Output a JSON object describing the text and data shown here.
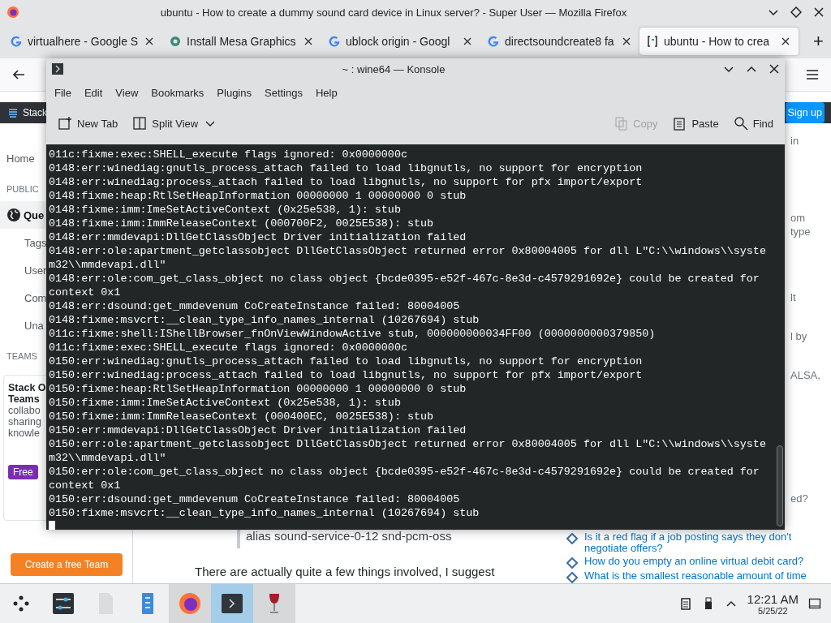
{
  "browser": {
    "title": "ubuntu - How to create a dummy sound card device in Linux server? - Super User — Mozilla Firefox",
    "tabs": [
      {
        "label": "virtualhere - Google S",
        "kind": "google",
        "selected": false
      },
      {
        "label": "Install Mesa Graphics",
        "kind": "gear",
        "selected": false
      },
      {
        "label": "ublock origin - Googl",
        "kind": "google",
        "selected": false
      },
      {
        "label": "directsoundcreate8 fa",
        "kind": "google",
        "selected": false
      },
      {
        "label": "ubuntu - How to crea",
        "kind": "stack",
        "selected": true
      }
    ],
    "new_tab": "+"
  },
  "site": {
    "header": {
      "brand": "Stack",
      "signup": "Sign up"
    },
    "left_nav": [
      {
        "kind": "link",
        "label": "Home",
        "selected": false
      },
      {
        "kind": "heading",
        "label": "PUBLIC"
      },
      {
        "kind": "globe",
        "label": "Que",
        "selected": true
      },
      {
        "kind": "sub",
        "label": "Tags",
        "selected": false
      },
      {
        "kind": "sub",
        "label": "User",
        "selected": false
      },
      {
        "kind": "sub",
        "label": "Com",
        "selected": false
      },
      {
        "kind": "sub",
        "label": "Una",
        "selected": false
      },
      {
        "kind": "heading",
        "label": "TEAMS"
      }
    ],
    "teams_card": {
      "title": "Stack O",
      "title_2": "Teams",
      "lines": [
        "collabo",
        "sharing",
        "knowle"
      ],
      "badge": "Free",
      "button": "Create a free Team"
    },
    "main": {
      "code_line": "alias sound-service-0-12 snd-pcm-oss",
      "paragraph": "There are actually quite a few things involved, I suggest"
    },
    "right": {
      "fragments": [
        "in",
        "om",
        "type",
        "lt",
        "l by",
        "ALSA,",
        "ed?"
      ],
      "hot_questions": [
        "Is it a red flag if a job posting says they don't negotiate offers?",
        "How do you empty an online virtual debit card?",
        "What is the smallest reasonable amount of time"
      ]
    }
  },
  "konsole": {
    "title": "~ : wine64 — Konsole",
    "menu": [
      "File",
      "Edit",
      "View",
      "Bookmarks",
      "Plugins",
      "Settings",
      "Help"
    ],
    "toolbar": [
      {
        "kind": "new-tab",
        "label": "New Tab",
        "disabled": false
      },
      {
        "kind": "split",
        "label": "Split View",
        "disabled": false
      },
      {
        "kind": "copy",
        "label": "Copy",
        "disabled": true
      },
      {
        "kind": "paste",
        "label": "Paste",
        "disabled": false
      },
      {
        "kind": "find",
        "label": "Find",
        "disabled": false
      }
    ],
    "lines": [
      "011c:fixme:exec:SHELL_execute flags ignored: 0x0000000c",
      "0148:err:winediag:gnutls_process_attach failed to load libgnutls, no support for encryption",
      "0148:err:winediag:process_attach failed to load libgnutls, no support for pfx import/export",
      "0148:fixme:heap:RtlSetHeapInformation 00000000 1 00000000 0 stub",
      "0148:fixme:imm:ImeSetActiveContext (0x25e538, 1): stub",
      "0148:fixme:imm:ImmReleaseContext (000700F2, 0025E538): stub",
      "0148:err:mmdevapi:DllGetClassObject Driver initialization failed",
      "0148:err:ole:apartment_getclassobject DllGetClassObject returned error 0x80004005 for dll L\"C:\\\\windows\\\\syste",
      "m32\\\\mmdevapi.dll\"",
      "0148:err:ole:com_get_class_object no class object {bcde0395-e52f-467c-8e3d-c4579291692e} could be created for",
      "context 0x1",
      "0148:err:dsound:get_mmdevenum CoCreateInstance failed: 80004005",
      "0148:fixme:msvcrt:__clean_type_info_names_internal (10267694) stub",
      "011c:fixme:shell:IShellBrowser_fnOnViewWindowActive stub, 000000000034FF00 (0000000000379850)",
      "011c:fixme:exec:SHELL_execute flags ignored: 0x0000000c",
      "0150:err:winediag:gnutls_process_attach failed to load libgnutls, no support for encryption",
      "0150:err:winediag:process_attach failed to load libgnutls, no support for pfx import/export",
      "0150:fixme:heap:RtlSetHeapInformation 00000000 1 00000000 0 stub",
      "0150:fixme:imm:ImeSetActiveContext (0x25e538, 1): stub",
      "0150:fixme:imm:ImmReleaseContext (000400EC, 0025E538): stub",
      "0150:err:mmdevapi:DllGetClassObject Driver initialization failed",
      "0150:err:ole:apartment_getclassobject DllGetClassObject returned error 0x80004005 for dll L\"C:\\\\windows\\\\syste",
      "m32\\\\mmdevapi.dll\"",
      "0150:err:ole:com_get_class_object no class object {bcde0395-e52f-467c-8e3d-c4579291692e} could be created for",
      "context 0x1",
      "0150:err:dsound:get_mmdevenum CoCreateInstance failed: 80004005",
      "0150:fixme:msvcrt:__clean_type_info_names_internal (10267694) stub"
    ]
  },
  "taskbar": {
    "apps": [
      {
        "kind": "launcher",
        "open": false,
        "selected": false
      },
      {
        "kind": "settings",
        "open": false,
        "selected": false
      },
      {
        "kind": "file",
        "open": false,
        "selected": false
      },
      {
        "kind": "document",
        "open": false,
        "selected": false
      },
      {
        "kind": "firefox",
        "open": true,
        "selected": false
      },
      {
        "kind": "terminal",
        "open": true,
        "selected": true
      },
      {
        "kind": "wine",
        "open": true,
        "selected": false
      }
    ],
    "time": "12:21 AM",
    "date": "5/25/22"
  }
}
